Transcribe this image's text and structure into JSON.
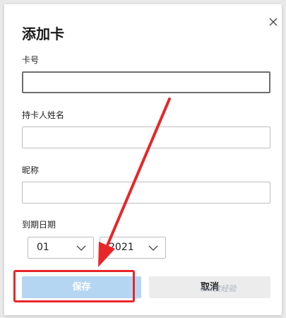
{
  "dialog": {
    "title": "添加卡",
    "close_icon": "close-icon"
  },
  "fields": {
    "card_number_label": "卡号",
    "card_number_value": "",
    "cardholder_label": "持卡人姓名",
    "cardholder_value": "",
    "nickname_label": "昵称",
    "nickname_value": ""
  },
  "expiry": {
    "label": "到期日期",
    "month": "01",
    "year": "2021"
  },
  "buttons": {
    "save": "保存",
    "cancel": "取消"
  },
  "watermark": "Bai度经验",
  "colors": {
    "save_bg": "#b5d6f3",
    "annotation": "#e8262a"
  }
}
